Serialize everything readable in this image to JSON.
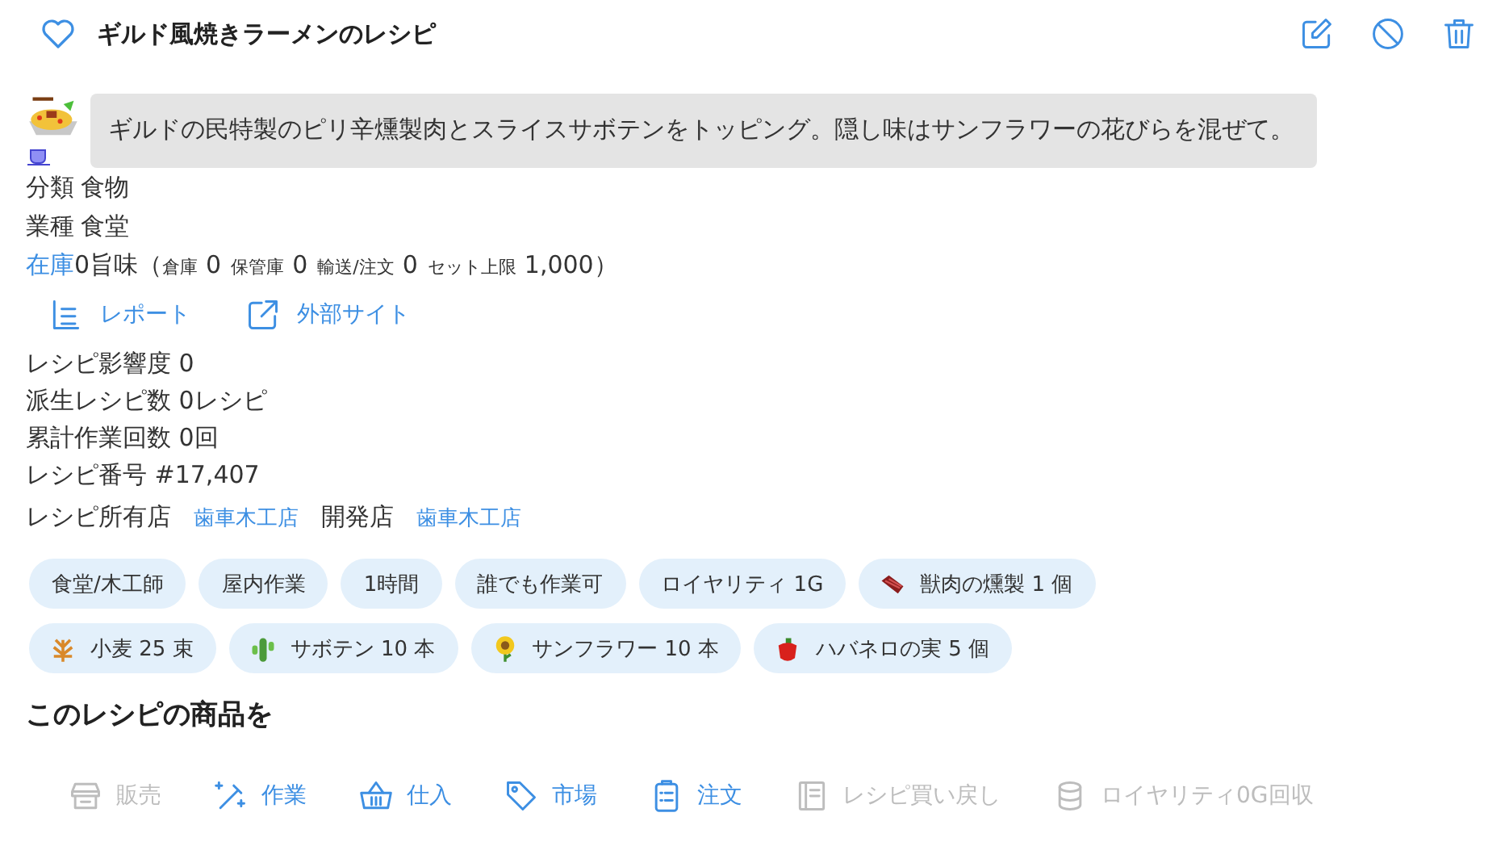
{
  "header": {
    "title": "ギルド風焼きラーメンのレシピ",
    "favorite": false
  },
  "description": "ギルドの民特製のピリ辛燻製肉とスライスサボテンをトッピング。隠し味はサンフラワーの花びらを混ぜて。",
  "category": {
    "label": "分類",
    "value": "食物"
  },
  "industry": {
    "label": "業種",
    "value": "食堂"
  },
  "stock": {
    "label": "在庫",
    "value": "0旨味",
    "open": "（",
    "close": "）",
    "parts": [
      {
        "label": "倉庫",
        "value": "0"
      },
      {
        "label": "保管庫",
        "value": "0"
      },
      {
        "label": "輸送/注文",
        "value": "0"
      },
      {
        "label": "セット上限",
        "value": "1,000"
      }
    ]
  },
  "links": [
    {
      "label": "レポート",
      "kind": "report"
    },
    {
      "label": "外部サイト",
      "kind": "external"
    }
  ],
  "details": [
    "レシピ影響度 0",
    "派生レシピ数 0レシピ",
    "累計作業回数 0回",
    "レシピ番号 #17,407"
  ],
  "shops": {
    "owner_label": "レシピ所有店",
    "owner": "歯車木工店",
    "developer_label": "開発店",
    "developer": "歯車木工店"
  },
  "tags": [
    {
      "label": "食堂/木工師",
      "kind": "plain"
    },
    {
      "label": "屋内作業",
      "kind": "plain"
    },
    {
      "label": "1時間",
      "kind": "plain"
    },
    {
      "label": "誰でも作業可",
      "kind": "plain"
    },
    {
      "label": "ロイヤリティ 1G",
      "kind": "plain"
    },
    {
      "label": "獣肉の燻製 1 個",
      "kind": "meat"
    },
    {
      "label": "小麦 25 束",
      "kind": "wheat"
    },
    {
      "label": "サボテン 10 本",
      "kind": "cactus"
    },
    {
      "label": "サンフラワー 10 本",
      "kind": "sunflower"
    },
    {
      "label": "ハバネロの実 5 個",
      "kind": "pepper"
    }
  ],
  "section_title": "このレシピの商品を",
  "actions": [
    {
      "label": "販売",
      "kind": "shop",
      "disabled": true
    },
    {
      "label": "作業",
      "kind": "wand",
      "disabled": false
    },
    {
      "label": "仕入",
      "kind": "basket",
      "disabled": false
    },
    {
      "label": "市場",
      "kind": "tag",
      "disabled": false
    },
    {
      "label": "注文",
      "kind": "clipboard",
      "disabled": false
    },
    {
      "label": "レシピ買い戻し",
      "kind": "book",
      "disabled": true
    },
    {
      "label": "ロイヤリティ0G回収",
      "kind": "coins",
      "disabled": true
    }
  ]
}
